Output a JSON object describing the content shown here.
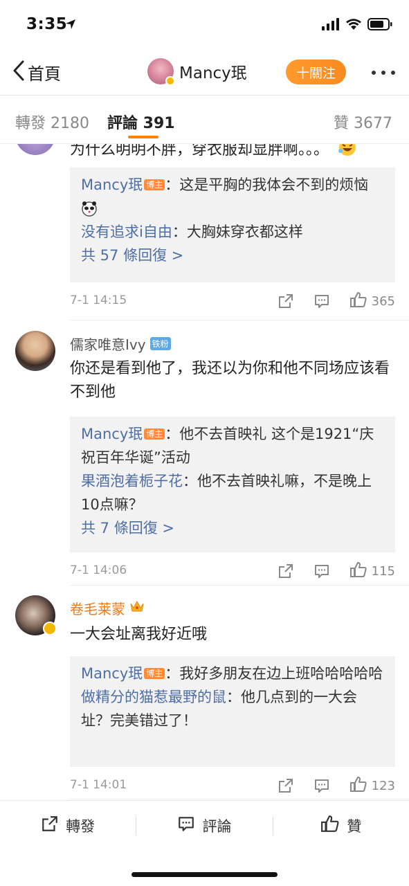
{
  "status": {
    "time": "3:35"
  },
  "nav": {
    "back_label": "首頁",
    "title": "Mancy珉",
    "follow_label": "十關注"
  },
  "tabs": {
    "repost": "轉發 2180",
    "comment": "評論 391",
    "like": "贊 3677"
  },
  "comments": [
    {
      "text": "为什么明明不胖，穿衣服却显胖啊。。。",
      "replies": [
        {
          "name": "Mancy珉",
          "badge": "博主",
          "text": "：这是平胸的我体会不到的烦恼"
        },
        {
          "name": "没有追求i自由",
          "text": "：大胸妹穿衣都这样"
        }
      ],
      "more": "共 57 條回復 >",
      "time": "7-1 14:15",
      "likes": "365"
    },
    {
      "name": "儒家唯意Ivy",
      "fan_badge": "铁粉",
      "text": "你还是看到他了，我还以为你和他不同场应该看不到他",
      "replies": [
        {
          "name": "Mancy珉",
          "badge": "博主",
          "text": "：他不去首映礼 这个是1921“庆祝百年华诞”活动"
        },
        {
          "name": "果酒泡着栀子花",
          "text": "：他不去首映礼嘛，不是晚上10点嘛？"
        }
      ],
      "more": "共 7 條回復 >",
      "time": "7-1 14:06",
      "likes": "115"
    },
    {
      "name": "卷毛莱蒙",
      "text": "一大会址离我好近哦",
      "replies": [
        {
          "name": "Mancy珉",
          "badge": "博主",
          "text": "：我好多朋友在边上班哈哈哈哈哈"
        },
        {
          "name": "做精分的猫惹最野的鼠",
          "text": "：他几点到的一大会址？完美错过了！"
        }
      ],
      "time": "7-1 14:01",
      "likes": "123"
    }
  ],
  "bottom_bar": {
    "repost": "轉發",
    "comment": "評論",
    "like": "贊"
  },
  "colors": {
    "accent": "#ff8200",
    "link": "#4f6ea5",
    "vip_name": "#f07a16",
    "reply_bg": "#f2f2f2"
  }
}
